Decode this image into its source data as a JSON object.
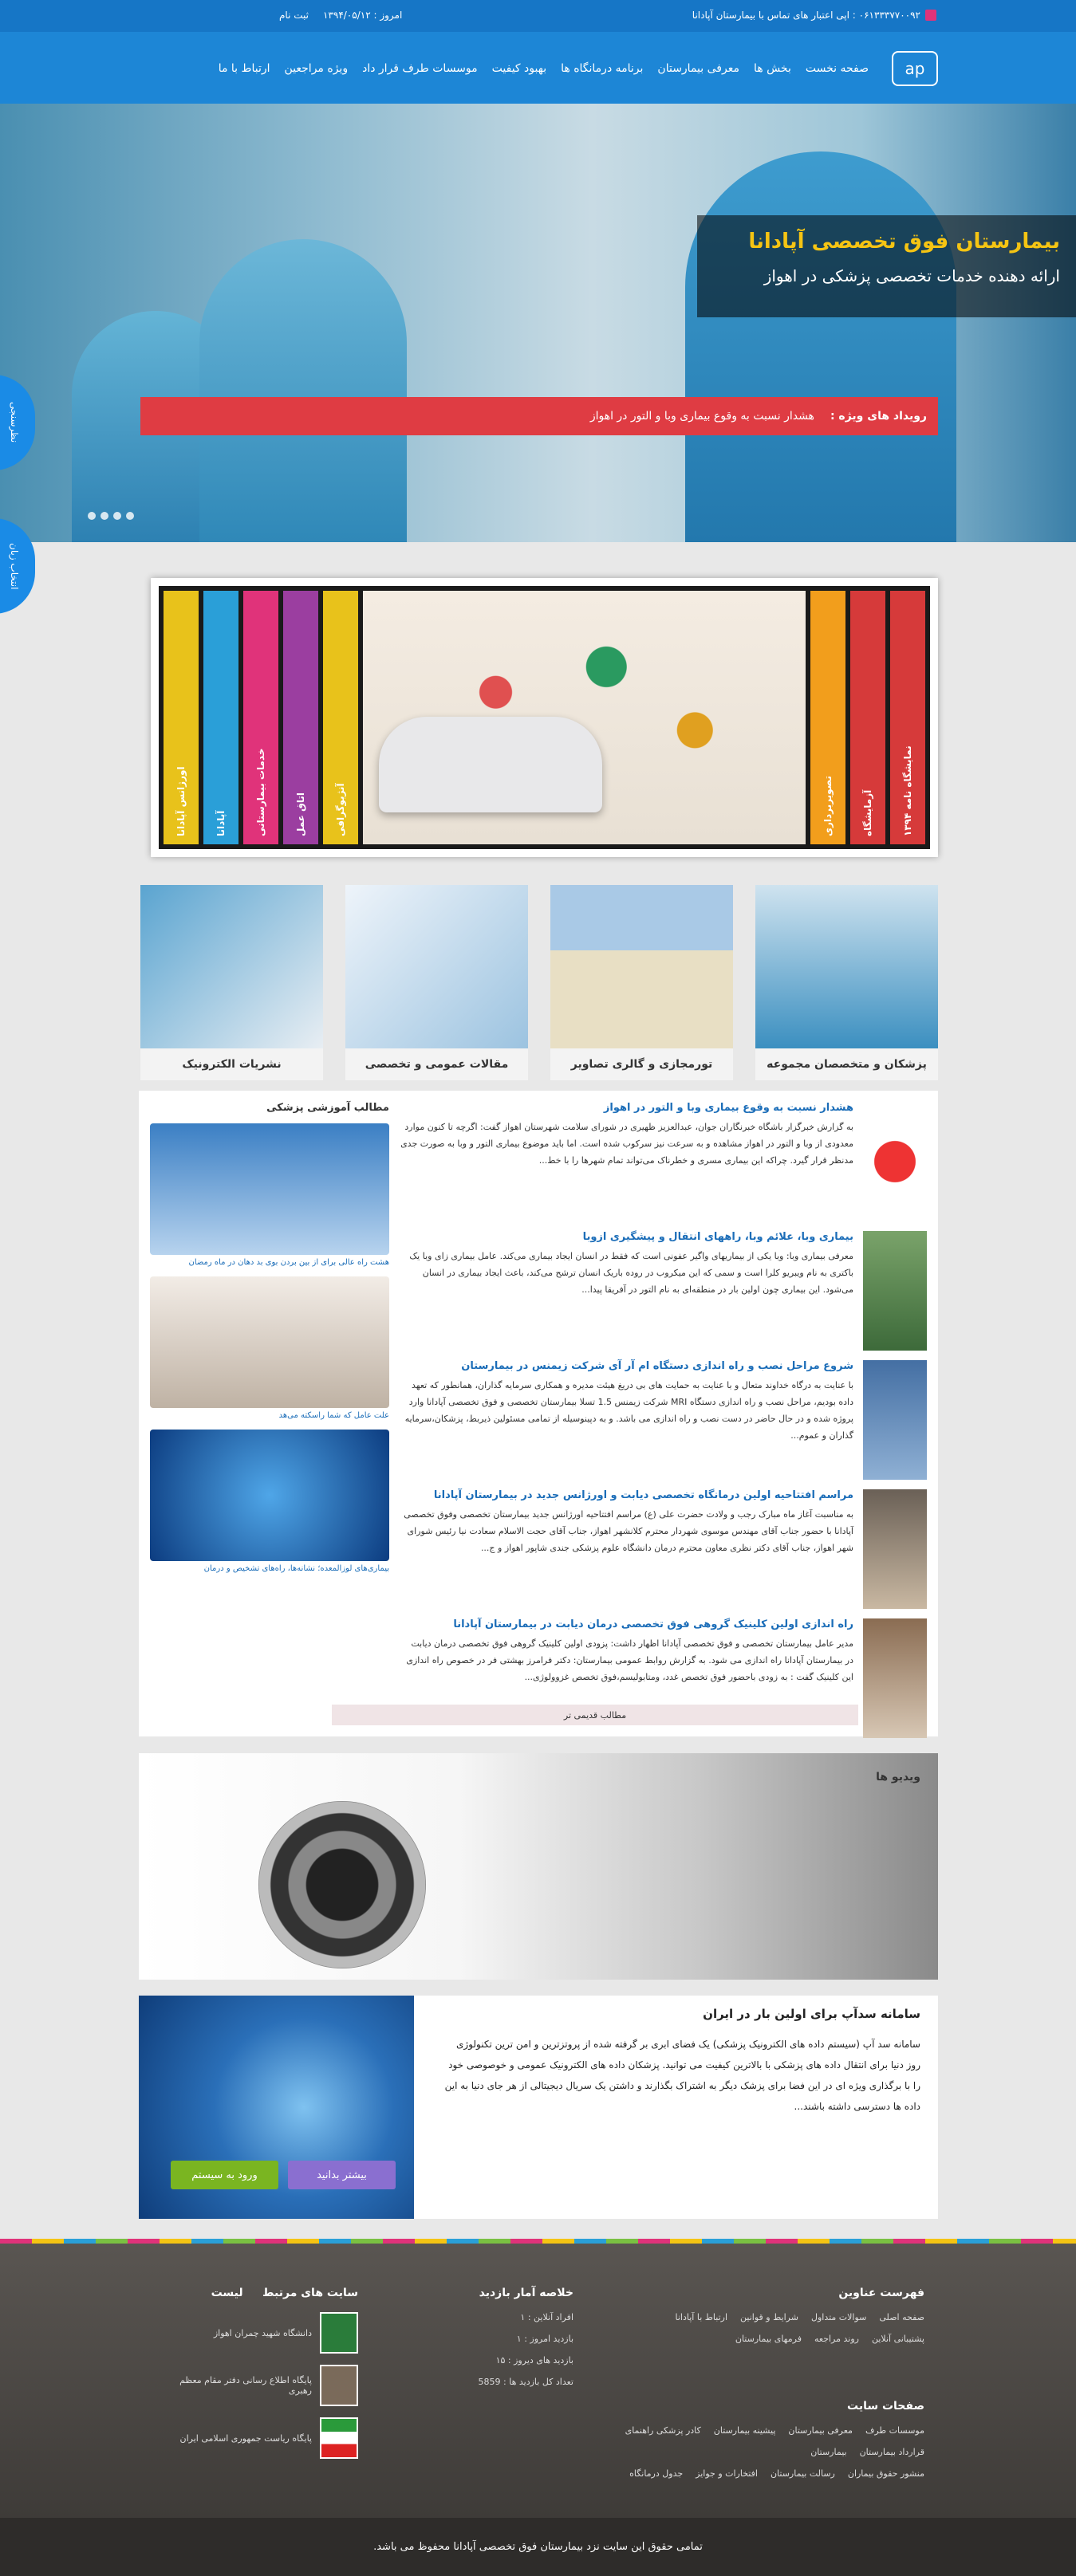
{
  "topbar": {
    "phone": "۰۶۱۳۳۳۷۷۰۰۹۲ : اپی اعتبار های تماس با بیمارستان آپادانا",
    "date": "امروز : ۱۳۹۴/۰۵/۱۲",
    "register": "ثبت نام"
  },
  "nav": {
    "logo": "ap",
    "items": [
      "صفحه نخست",
      "بخش ها",
      "معرفی بیمارستان",
      "برنامه درمانگاه ها",
      "بهبود کیفیت",
      "موسسات طرف قرار داد",
      "ویژه مراجعین",
      "ارتباط با ما"
    ]
  },
  "hero": {
    "title": "بیمارستان فوق تخصصی آپادانا",
    "subtitle": "ارائه دهنده خدمات تخصصی پزشکی در اهواز"
  },
  "news": {
    "label": "رویداد های ویژه :",
    "text": "هشدار نسبت به وقوع بیماری وبا و التور در اهواز"
  },
  "sidetabs": [
    "نظرسنجی",
    "انتخاب زبان"
  ],
  "accordion": {
    "tabs": [
      {
        "label": "اورژانس آپادانا",
        "color": "#e8c21b"
      },
      {
        "label": "آپادانا",
        "color": "#2a9fd8"
      },
      {
        "label": "خدمات بیمارستانی",
        "color": "#e0337a"
      },
      {
        "label": "اتاق عمل",
        "color": "#9b3ea0"
      },
      {
        "label": "آنژیوگرافی",
        "color": "#e8c21b"
      },
      {
        "label": "تصویربرداری",
        "color": "#f29e1c"
      },
      {
        "label": "آزمایشگاه",
        "color": "#d63a3a"
      },
      {
        "label": "نمایشگاه نامه ۱۳۹۴",
        "color": "#d63a3a"
      }
    ]
  },
  "cards": [
    {
      "label": "پزشکان و متخصصان مجموعه"
    },
    {
      "label": "تورمجازی و گالری تصاویر"
    },
    {
      "label": "مقالات عمومی و تخصصی"
    },
    {
      "label": "نشریات الکترونیک"
    }
  ],
  "articles": [
    {
      "title": "هشدار نسبت به وقوع بیماری وبا و التور در اهواز",
      "text": "به گزارش خبرگزار باشگاه خبرنگاران جوان، عبدالعزیز ظهیری در شورای سلامت شهرستان اهواز گفت: اگرچه تا کنون موارد معدودی از وبا و التور در اهواز مشاهده و به سرعت نیز سرکوب شده است. اما باید موضوع بیماری التور و وبا به صورت جدی مدنظر قرار گیرد. چراکه این بیماری مسری و خطرناک می‌تواند تمام شهرها را با خط..."
    },
    {
      "title": "بیماری وبا، علائم وبا، راههای انتقال و پیشگیری ازوبا",
      "text": "معرفی بیماری وبا: وبا یکی از بیماریهای واگیر عفونی است که فقط در انسان ایجاد بیماری می‌کند. عامل بیماری زای وبا یک باکتری به نام ویبریو کلرا است و سمی که این میکروب در روده باریک انسان ترشح می‌کند، باعث ایجاد بیماری در انسان می‌شود. این بیماری چون اولین بار در منطقه‌ای به نام التور در آفریقا پیدا..."
    },
    {
      "title": "شروع مراحل نصب و راه اندازی دستگاه ام آر آی شرکت زیمنس در بیمارستان",
      "text": "با عنایت به درگاه خداوند متعال و با عنایت به حمایت های بی دریغ هیئت مدیره و همکاری سرمایه گذاران، همانطور که تعهد داده بودیم، مراحل نصب و راه اندازی دستگاه MRI شرکت زیمنس 1.5 تسلا بیمارستان تخصصی و فوق تخصصی آپادانا وارد پروژه شده و در حال حاضر در دست نصب و راه اندازی می باشد. و به دپینوسیله از تمامی مسئولین ذیربط، پزشکان،سرمایه گذاران و عموم..."
    },
    {
      "title": "مراسم افتتاحیه اولین درمانگاه تخصصی دیابت و اورژانس جدید در بیمارستان آپادانا",
      "text": "به مناسبت آغاز ماه مبارک رجب و ولادت حضرت علی (ع) مراسم افتتاحیه اورژانس جدید بیمارستان تخصصی وفوق تخصصی آپادانا با حضور جناب آقای مهندس موسوی شهردار محترم کلانشهر اهواز، جناب آقای حجت الاسلام سعادت نیا رئیس شورای شهر اهواز، جناب آقای دکتر نظری معاون محترم درمان دانشگاه علوم پزشکی جندی شاپور اهواز و ج..."
    },
    {
      "title": "راه اندازی اولین کلینیک گروهی فوق تخصصی درمان دیابت در بیمارستان آپادانا",
      "text": "مدیر عامل بیمارستان تخصصی و فوق تخصصی آپادانا اظهار داشت: پزودی اولین کلینیک گروهی فوق تخصصی درمان دیابت در بیمارستان آپادانا راه اندازی می شود. به گزارش روابط عمومی بیمارستان: دکتر فرامرز بهشتی فر در خصوص راه اندازی این کلینیک گفت : به زودی باحضور فوق تخصص غدد، ومتابولیسم،فوق تخصص غزوولوژی..."
    }
  ],
  "more_label": "مطالب قدیمی تر",
  "edu": {
    "title": "مطالب آموزشی پزشکی",
    "items": [
      {
        "label": "هشت راه عالی برای از بین بردن بوی بد دهان در ماه رمضان"
      },
      {
        "label": "علت عامل که شما راسکته می‌هد"
      },
      {
        "label": "بیماری‌های لوزالمعده؛ نشانه‌ها، راه‌های تشخیص و درمان"
      }
    ]
  },
  "videos": {
    "title": "ویدیو ها"
  },
  "cloud": {
    "title": "سامانه سدآپ برای اولین بار در ایران",
    "text": "سامانه سد آپ (سیستم داده های الکترونیک پزشکی) یک فضای ابری بر گرفته شده از پروتزترین و امن ترین تکنولوژی روز دنیا برای انتقال داده های پزشکی با بالاترین کیفیت می توانید. پزشکان داده های الکترونیک عمومی و خوصوصی خود را با برگذاری ویژه ای در این فضا برای پزشک دیگر به اشتراک بگذارند و داشتن یک سریال دیجیتالی از هر جای دنیا به این داده ها دسترسی داشته باشند...",
    "more_btn": "بیشتر بدانید",
    "login_btn": "ورود به سیستم"
  },
  "footer": {
    "index_title": "فهرست عناوین",
    "index_rows": [
      [
        "صفحه اصلی",
        "سوالات متداول",
        "شرایط و قوانین",
        "ارتباط با آپادانا"
      ],
      [
        "پشتیبانی آنلاین",
        "روند مراجعه",
        "فرمهای بیمارستان"
      ]
    ],
    "pages_title": "صفحات سایت",
    "pages_rows": [
      [
        "موسسات طرف",
        "معرفی بیمارستان",
        "پیشینه بیمارستان",
        "کادر پزشکی راهنمای"
      ],
      [
        "قرارداد بیمارستان",
        "",
        "بیمارستان",
        ""
      ],
      [
        "منشور حقوق بیماران",
        "رسالت بیمارستان",
        "افتخارات و جوایز",
        "جدول درمانگاه"
      ]
    ],
    "stats_title": "خلاصه آمار بازدید",
    "stats": [
      "افراد آنلاین : ۱",
      "بازدید امروز : ۱",
      "بازدید های دیروز : ۱۵",
      "تعداد کل بازدید ها : 5859"
    ],
    "links_title": "سایت های مرتبط",
    "links_sub": "لیست",
    "links": [
      "دانشگاه شهید چمران اهواز",
      "پایگاه اطلاع رسانی دفتر مقام معظم رهبری",
      "پایگاه ریاست جمهوری اسلامی ایران"
    ],
    "copyright": "تمامی حقوق این سایت نزد بیمارستان فوق تخصصی آپادانا محفوظ می باشد."
  }
}
